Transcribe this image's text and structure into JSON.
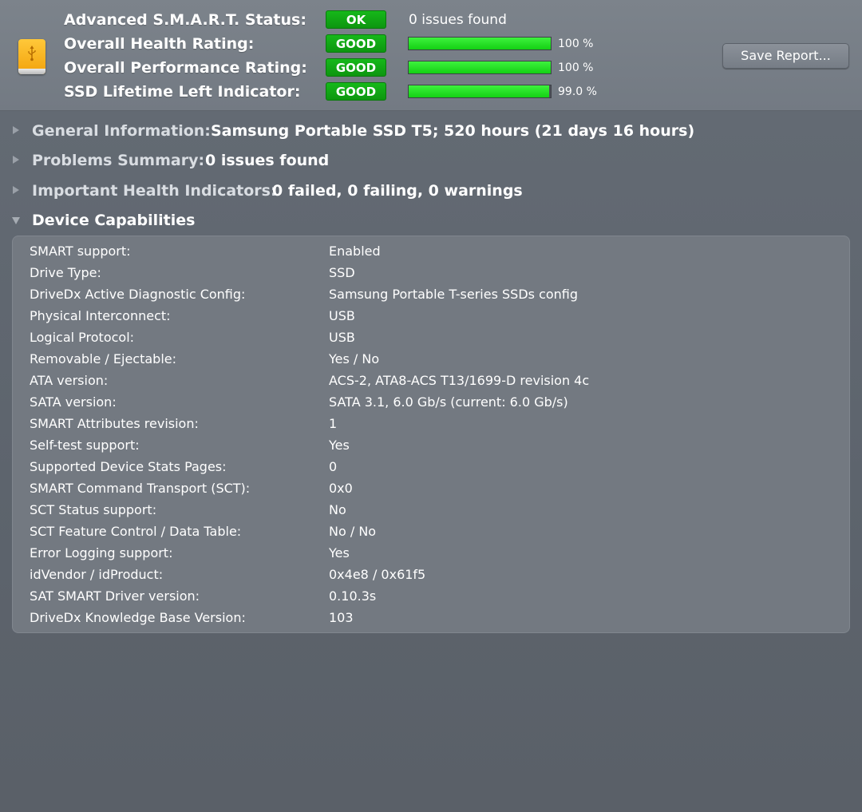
{
  "header": {
    "drive_icon": "usb-external-drive-icon",
    "rows": [
      {
        "label": "Advanced S.M.A.R.T. Status:",
        "badge": "OK",
        "note": "0 issues found"
      },
      {
        "label": "Overall Health Rating:",
        "badge": "GOOD",
        "percent": 100,
        "value_text": "100 %"
      },
      {
        "label": "Overall Performance Rating:",
        "badge": "GOOD",
        "percent": 100,
        "value_text": "100 %"
      },
      {
        "label": "SSD Lifetime Left Indicator:",
        "badge": "GOOD",
        "percent": 99.0,
        "value_text": "99.0 %"
      }
    ],
    "save_button": "Save Report..."
  },
  "sections": [
    {
      "label": "General Information:",
      "value": "Samsung Portable SSD T5; 520 hours (21 days 16 hours)",
      "expanded": false
    },
    {
      "label": "Problems Summary:",
      "value": "0 issues found",
      "expanded": false
    },
    {
      "label": "Important Health Indicators:",
      "value": "0 failed, 0 failing, 0 warnings",
      "expanded": false
    },
    {
      "label": "Device Capabilities",
      "value": "",
      "expanded": true
    }
  ],
  "capabilities": [
    {
      "label": "SMART support:",
      "value": "Enabled"
    },
    {
      "label": "Drive Type:",
      "value": "SSD"
    },
    {
      "label": "DriveDx Active Diagnostic Config:",
      "value": "Samsung Portable T-series SSDs config"
    },
    {
      "label": "Physical Interconnect:",
      "value": "USB"
    },
    {
      "label": "Logical Protocol:",
      "value": "USB"
    },
    {
      "label": "Removable / Ejectable:",
      "value": "Yes / No"
    },
    {
      "label": "ATA version:",
      "value": "ACS-2, ATA8-ACS T13/1699-D revision 4c"
    },
    {
      "label": "SATA version:",
      "value": "SATA 3.1, 6.0 Gb/s (current: 6.0 Gb/s)"
    },
    {
      "label": "SMART Attributes revision:",
      "value": "1"
    },
    {
      "label": "Self-test support:",
      "value": "Yes"
    },
    {
      "label": "Supported Device Stats Pages:",
      "value": "0"
    },
    {
      "label": "SMART Command Transport (SCT):",
      "value": "0x0"
    },
    {
      "label": "SCT Status support:",
      "value": "No"
    },
    {
      "label": "SCT Feature Control / Data Table:",
      "value": "No / No"
    },
    {
      "label": "Error Logging support:",
      "value": "Yes"
    },
    {
      "label": "idVendor / idProduct:",
      "value": "0x4e8 / 0x61f5"
    },
    {
      "label": "SAT SMART Driver version:",
      "value": "0.10.3s"
    },
    {
      "label": "DriveDx Knowledge Base Version:",
      "value": "103"
    }
  ],
  "colors": {
    "status_good": "#12a815",
    "progress_fill": "#22dd22",
    "background": "#5d646d",
    "header": "#777e87"
  }
}
